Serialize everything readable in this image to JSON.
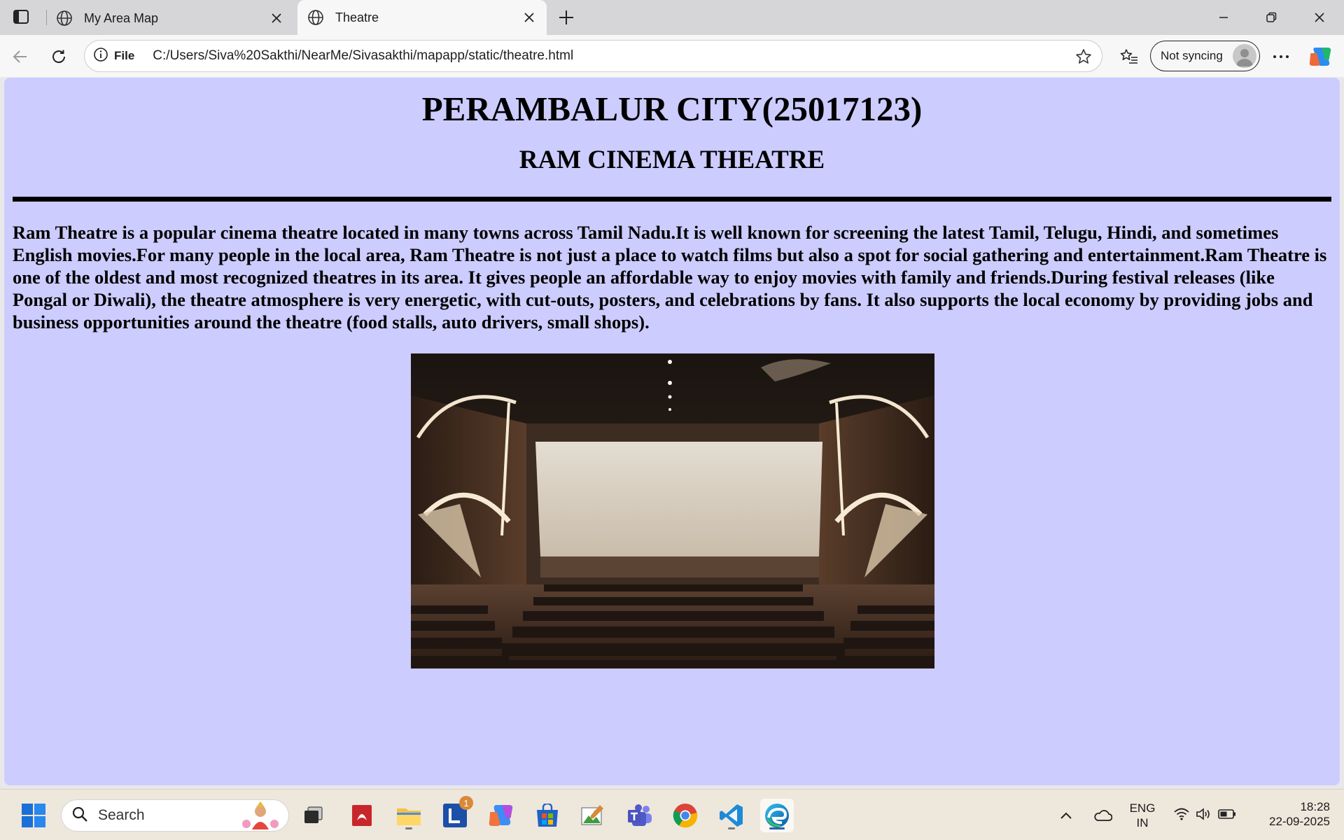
{
  "browser": {
    "tabs": [
      {
        "title": "My Area Map",
        "active": false
      },
      {
        "title": "Theatre",
        "active": true
      }
    ],
    "address_bar": {
      "scheme_label": "File",
      "url": "C:/Users/Siva%20Sakthi/NearMe/Sivasakthi/mapapp/static/theatre.html"
    },
    "profile": {
      "sync_label": "Not syncing"
    }
  },
  "page": {
    "heading": "PERAMBALUR CITY(25017123)",
    "subheading": "RAM CINEMA THEATRE",
    "paragraph": "Ram Theatre is a popular cinema theatre located in many towns across Tamil Nadu.It is well known for screening the latest Tamil, Telugu, Hindi, and sometimes English movies.For many people in the local area, Ram Theatre is not just a place to watch films but also a spot for social gathering and entertainment.Ram Theatre is one of the oldest and most recognized theatres in its area. It gives people an affordable way to enjoy movies with family and friends.During festival releases (like Pongal or Diwali), the theatre atmosphere is very energetic, with cut-outs, posters, and celebrations by fans. It also supports the local economy by providing jobs and business opportunities around the theatre (food stalls, auto drivers, small shops)."
  },
  "taskbar": {
    "search_placeholder": "Search",
    "lens_badge": "1",
    "language": {
      "line1": "ENG",
      "line2": "IN"
    },
    "clock": {
      "time": "18:28",
      "date": "22-09-2025"
    }
  },
  "colors": {
    "page_background": "#ccccff",
    "taskbar_background": "#eee7dc"
  }
}
